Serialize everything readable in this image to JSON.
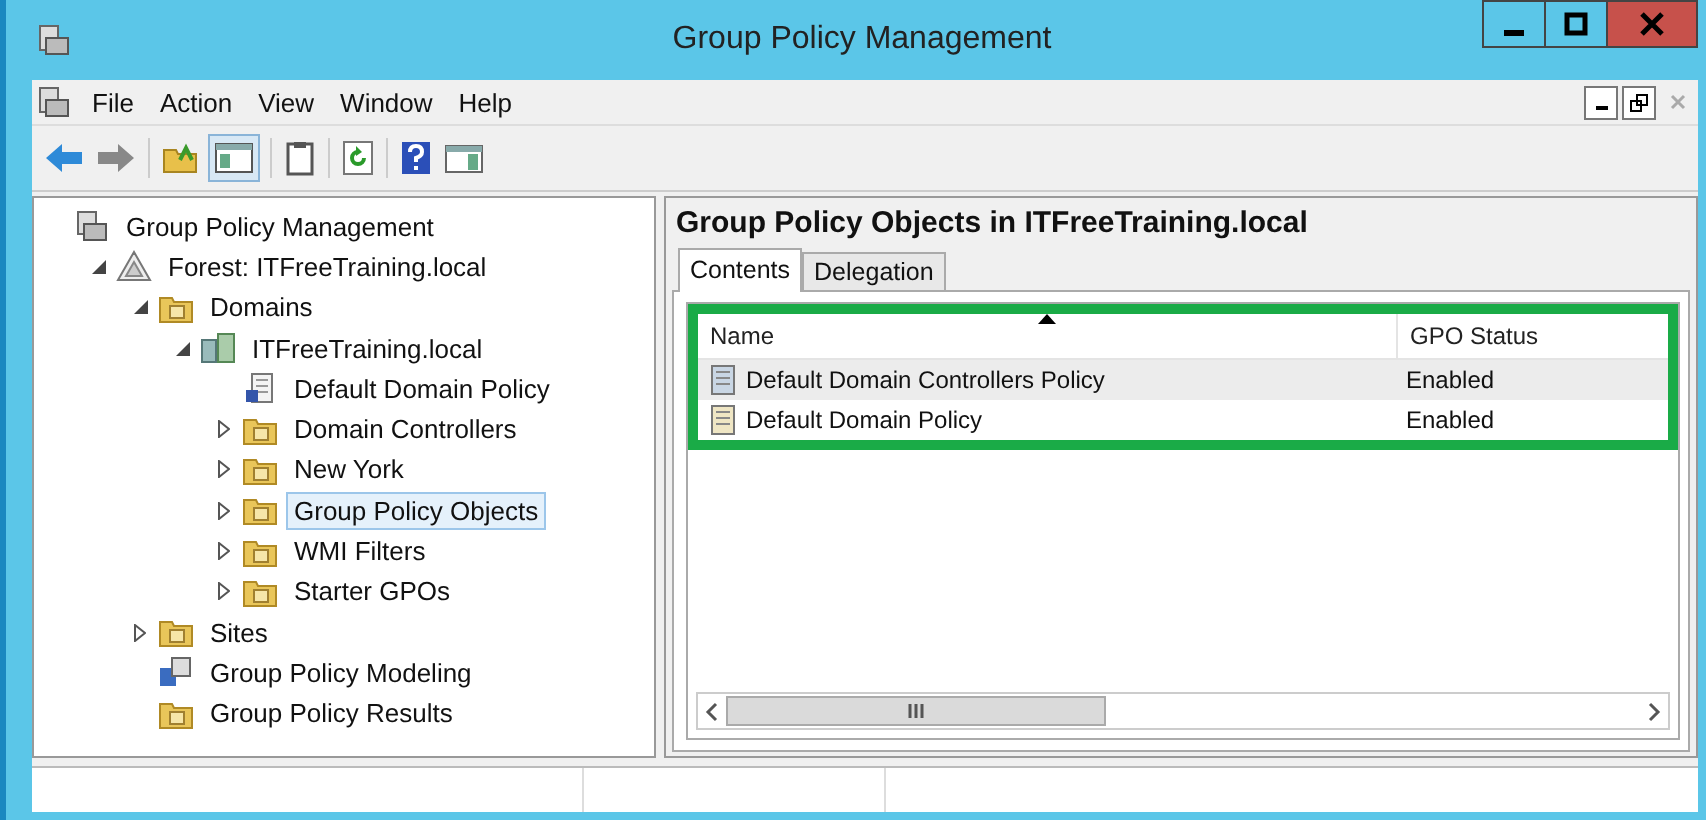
{
  "window": {
    "title": "Group Policy Management"
  },
  "menu": [
    "File",
    "Action",
    "View",
    "Window",
    "Help"
  ],
  "tree": [
    {
      "label": "Group Policy Management",
      "kind": "console",
      "expandable": false,
      "selected": false,
      "children": [
        {
          "label": "Forest: ITFreeTraining.local",
          "kind": "forest",
          "expandable": true,
          "expanded": true,
          "selected": false,
          "children": [
            {
              "label": "Domains",
              "kind": "domains",
              "expandable": true,
              "expanded": true,
              "selected": false,
              "children": [
                {
                  "label": "ITFreeTraining.local",
                  "kind": "domain",
                  "expandable": true,
                  "expanded": true,
                  "selected": false,
                  "children": [
                    {
                      "label": "Default Domain Policy",
                      "kind": "link",
                      "expandable": false,
                      "selected": false
                    },
                    {
                      "label": "Domain Controllers",
                      "kind": "ou",
                      "expandable": true,
                      "expanded": false,
                      "selected": false
                    },
                    {
                      "label": "New York",
                      "kind": "ou",
                      "expandable": true,
                      "expanded": false,
                      "selected": false
                    },
                    {
                      "label": "Group Policy Objects",
                      "kind": "folder",
                      "expandable": true,
                      "expanded": false,
                      "selected": true
                    },
                    {
                      "label": "WMI Filters",
                      "kind": "folder",
                      "expandable": true,
                      "expanded": false,
                      "selected": false
                    },
                    {
                      "label": "Starter GPOs",
                      "kind": "folder",
                      "expandable": true,
                      "expanded": false,
                      "selected": false
                    }
                  ]
                }
              ]
            },
            {
              "label": "Sites",
              "kind": "folder",
              "expandable": true,
              "expanded": false,
              "selected": false
            },
            {
              "label": "Group Policy Modeling",
              "kind": "modeling",
              "expandable": false,
              "selected": false
            },
            {
              "label": "Group Policy Results",
              "kind": "folder",
              "expandable": false,
              "selected": false
            }
          ]
        }
      ]
    }
  ],
  "details": {
    "title": "Group Policy Objects in ITFreeTraining.local",
    "tabs": [
      {
        "label": "Contents",
        "selected": true
      },
      {
        "label": "Delegation",
        "selected": false
      }
    ],
    "highlighted": true,
    "columns": [
      "Name",
      "GPO Status"
    ],
    "rows": [
      {
        "name": "Default Domain Controllers Policy",
        "status": "Enabled",
        "selected": true
      },
      {
        "name": "Default Domain Policy",
        "status": "Enabled",
        "selected": false
      }
    ]
  }
}
